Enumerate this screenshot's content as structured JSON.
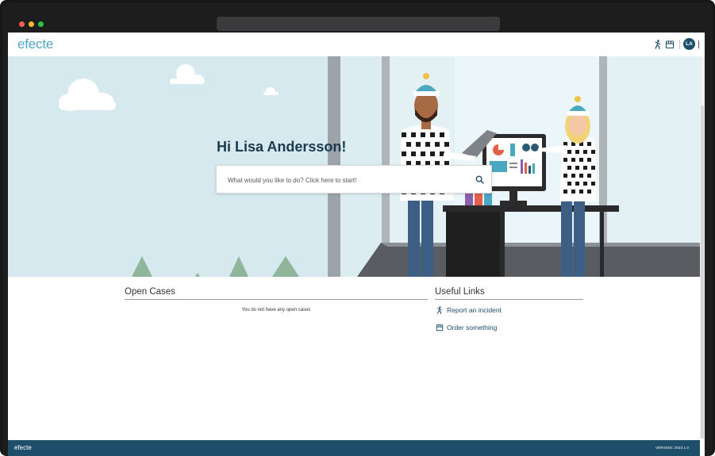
{
  "header": {
    "logo": "efecte",
    "avatar_initials": "LA",
    "icons": [
      "report-incident-icon",
      "order-store-icon"
    ]
  },
  "hero": {
    "greeting": "Hi Lisa Andersson!",
    "search_placeholder": "What would you like to do? Click here to start!"
  },
  "open_cases": {
    "title": "Open Cases",
    "empty_message": "You do not have any open cases"
  },
  "useful_links": {
    "title": "Useful Links",
    "items": [
      {
        "label": "Report an incident",
        "icon": "report-incident-icon"
      },
      {
        "label": "Order something",
        "icon": "order-store-icon"
      }
    ]
  },
  "footer": {
    "logo": "efecte",
    "version": "VERSION: 2023.1.0"
  },
  "colors": {
    "brand_navy": "#1d4f6b",
    "logo_teal": "#4fa8c8",
    "sky": "#d5e9ee"
  }
}
